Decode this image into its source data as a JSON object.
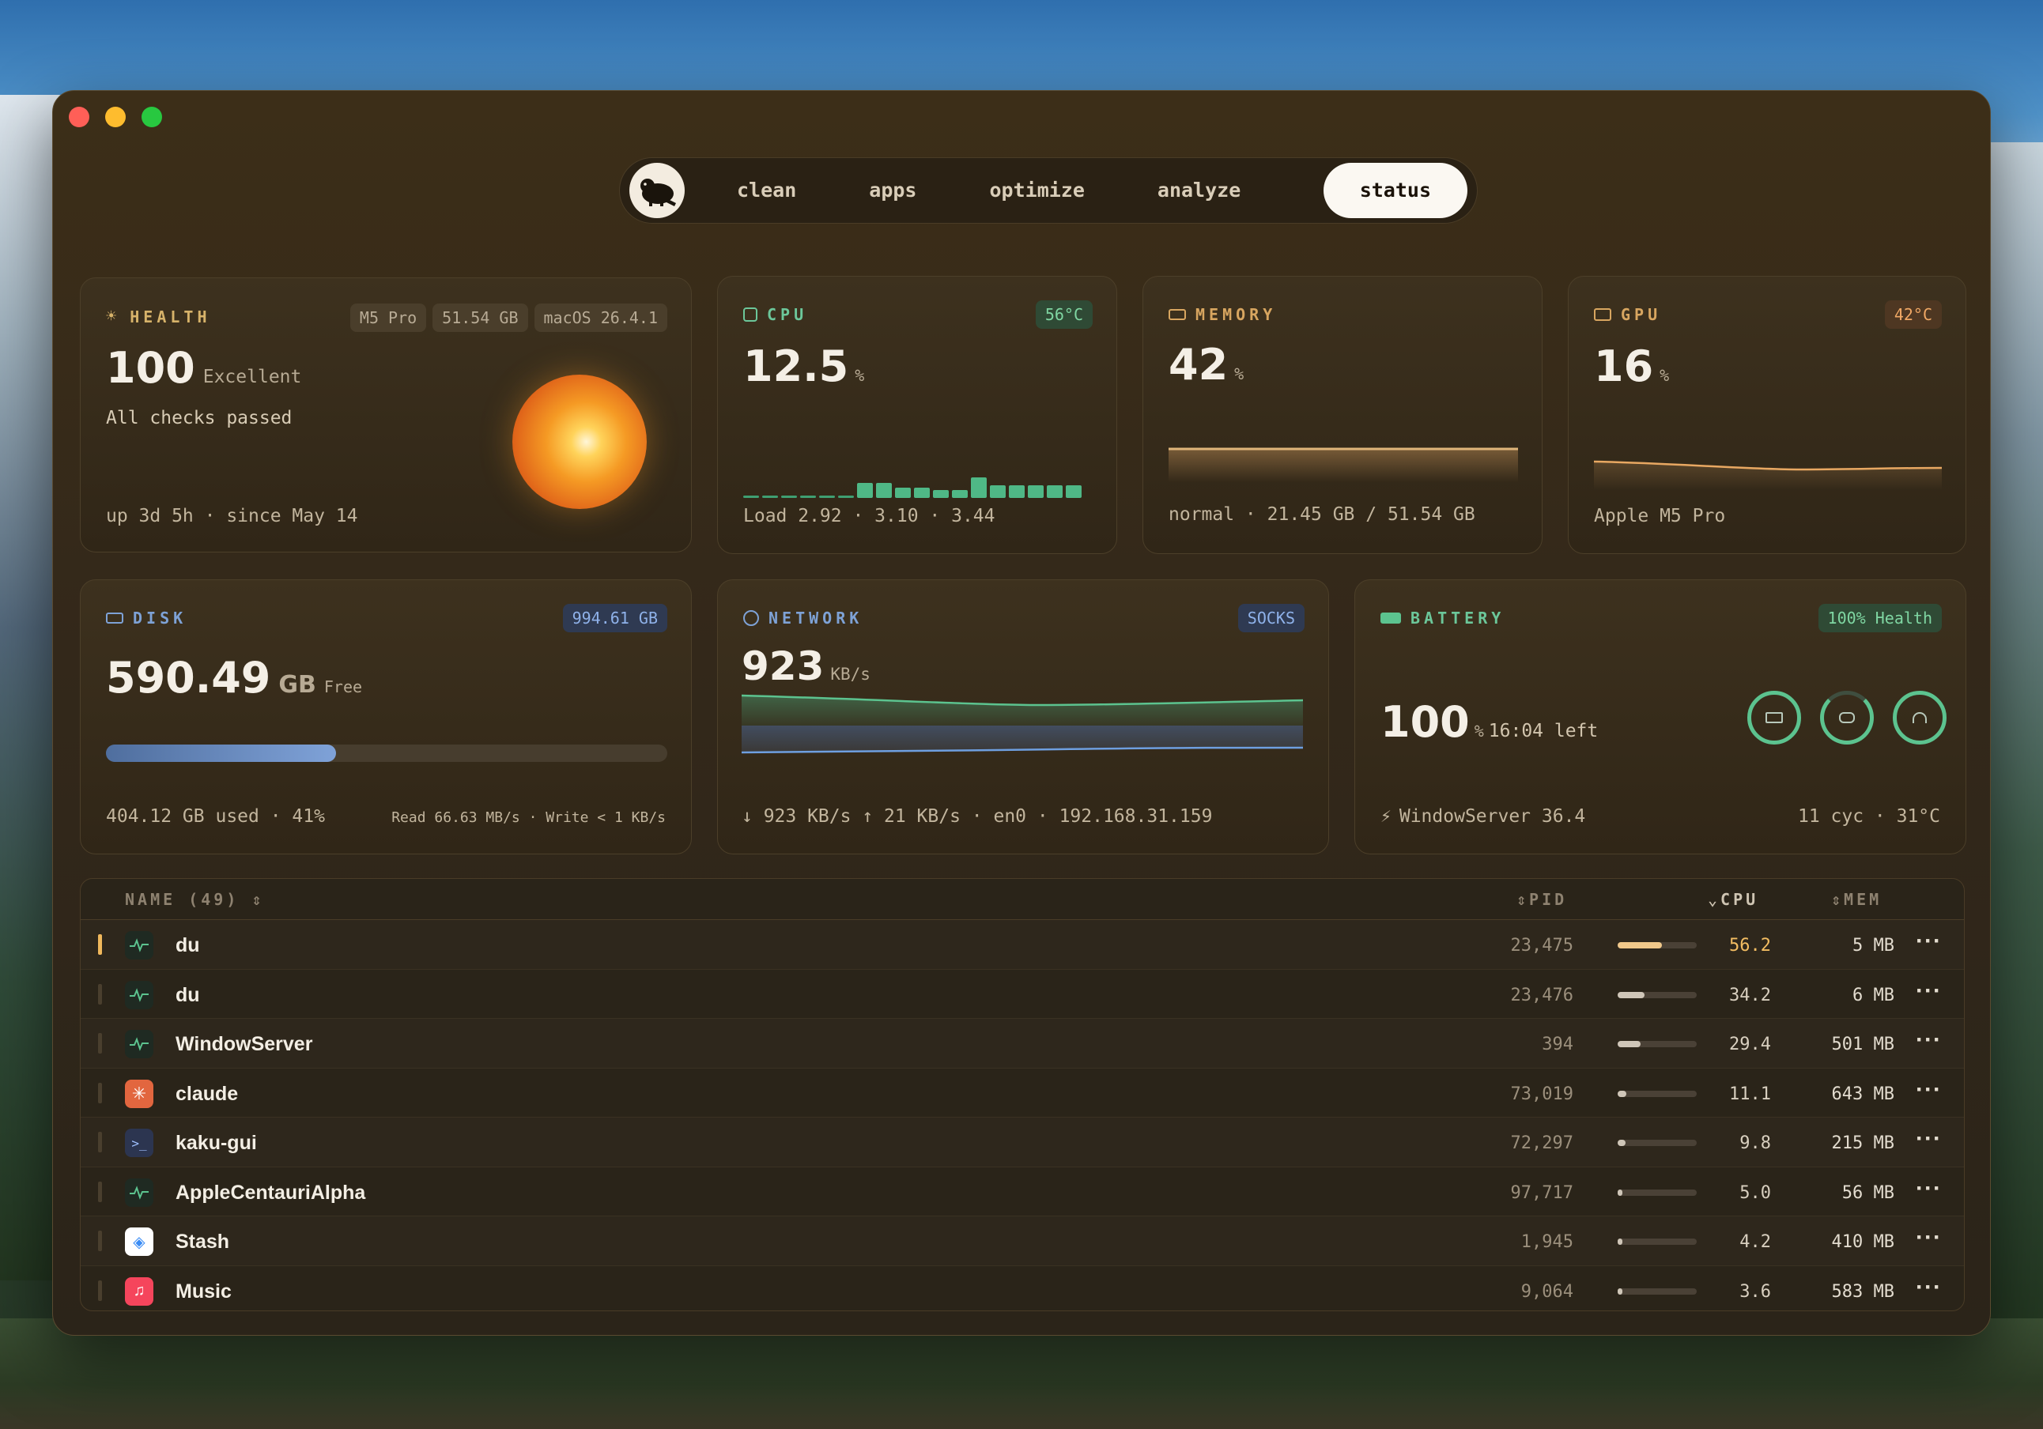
{
  "nav": {
    "tabs": [
      "clean",
      "apps",
      "optimize",
      "analyze"
    ],
    "active_tab": "status"
  },
  "health": {
    "title": "HEALTH",
    "badges": [
      "M5 Pro",
      "51.54 GB",
      "macOS 26.4.1"
    ],
    "score": "100",
    "rating": "Excellent",
    "checks": "All checks passed",
    "uptime": "up 3d 5h · since May 14"
  },
  "cpu": {
    "title": "CPU",
    "temp": "56°C",
    "value": "12.5",
    "unit": "%",
    "load": "Load 2.92 · 3.10 · 3.44",
    "history": [
      1,
      1,
      1,
      1,
      1,
      1,
      6,
      6,
      4,
      4,
      3,
      3,
      8,
      5,
      5,
      5,
      5,
      5
    ]
  },
  "memory": {
    "title": "MEMORY",
    "value": "42",
    "unit": "%",
    "detail": "normal · 21.45 GB / 51.54 GB"
  },
  "gpu": {
    "title": "GPU",
    "temp": "42°C",
    "value": "16",
    "unit": "%",
    "model": "Apple M5 Pro"
  },
  "disk": {
    "title": "DISK",
    "total": "994.61 GB",
    "free_value": "590.49",
    "free_unit": "GB",
    "free_label": "Free",
    "used_fraction": 0.41,
    "used": "404.12 GB used · 41%",
    "io": "Read 66.63 MB/s · Write < 1 KB/s"
  },
  "network": {
    "title": "NETWORK",
    "badge": "SOCKS",
    "value": "923",
    "unit": "KB/s",
    "detail": "↓ 923 KB/s  ↑ 21 KB/s · en0 · 192.168.31.159"
  },
  "battery": {
    "title": "BATTERY",
    "health": "100% Health",
    "value": "100",
    "unit": "%",
    "time_left": "16:04 left",
    "top_consumer": "WindowServer 36.4",
    "stats": "11 cyc · 31°C"
  },
  "table": {
    "headers": {
      "name": "NAME (49)",
      "pid": "PID",
      "cpu": "CPU",
      "mem": "MEM"
    },
    "rows": [
      {
        "name": "du",
        "pid": "23,475",
        "cpu": "56.2",
        "cpu_pct": 56.2,
        "mem": "5 MB",
        "icon": "activity-icon"
      },
      {
        "name": "du",
        "pid": "23,476",
        "cpu": "34.2",
        "cpu_pct": 34.2,
        "mem": "6 MB",
        "icon": "activity-icon"
      },
      {
        "name": "WindowServer",
        "pid": "394",
        "cpu": "29.4",
        "cpu_pct": 29.4,
        "mem": "501 MB",
        "icon": "activity-icon"
      },
      {
        "name": "claude",
        "pid": "73,019",
        "cpu": "11.1",
        "cpu_pct": 11.1,
        "mem": "643 MB",
        "icon": "claude-icon"
      },
      {
        "name": "kaku-gui",
        "pid": "72,297",
        "cpu": "9.8",
        "cpu_pct": 9.8,
        "mem": "215 MB",
        "icon": "terminal-icon"
      },
      {
        "name": "AppleCentauriAlpha",
        "pid": "97,717",
        "cpu": "5.0",
        "cpu_pct": 5.0,
        "mem": "56 MB",
        "icon": "activity-icon"
      },
      {
        "name": "Stash",
        "pid": "1,945",
        "cpu": "4.2",
        "cpu_pct": 4.2,
        "mem": "410 MB",
        "icon": "stash-icon"
      },
      {
        "name": "Music",
        "pid": "9,064",
        "cpu": "3.6",
        "cpu_pct": 3.6,
        "mem": "583 MB",
        "icon": "music-icon"
      }
    ]
  }
}
